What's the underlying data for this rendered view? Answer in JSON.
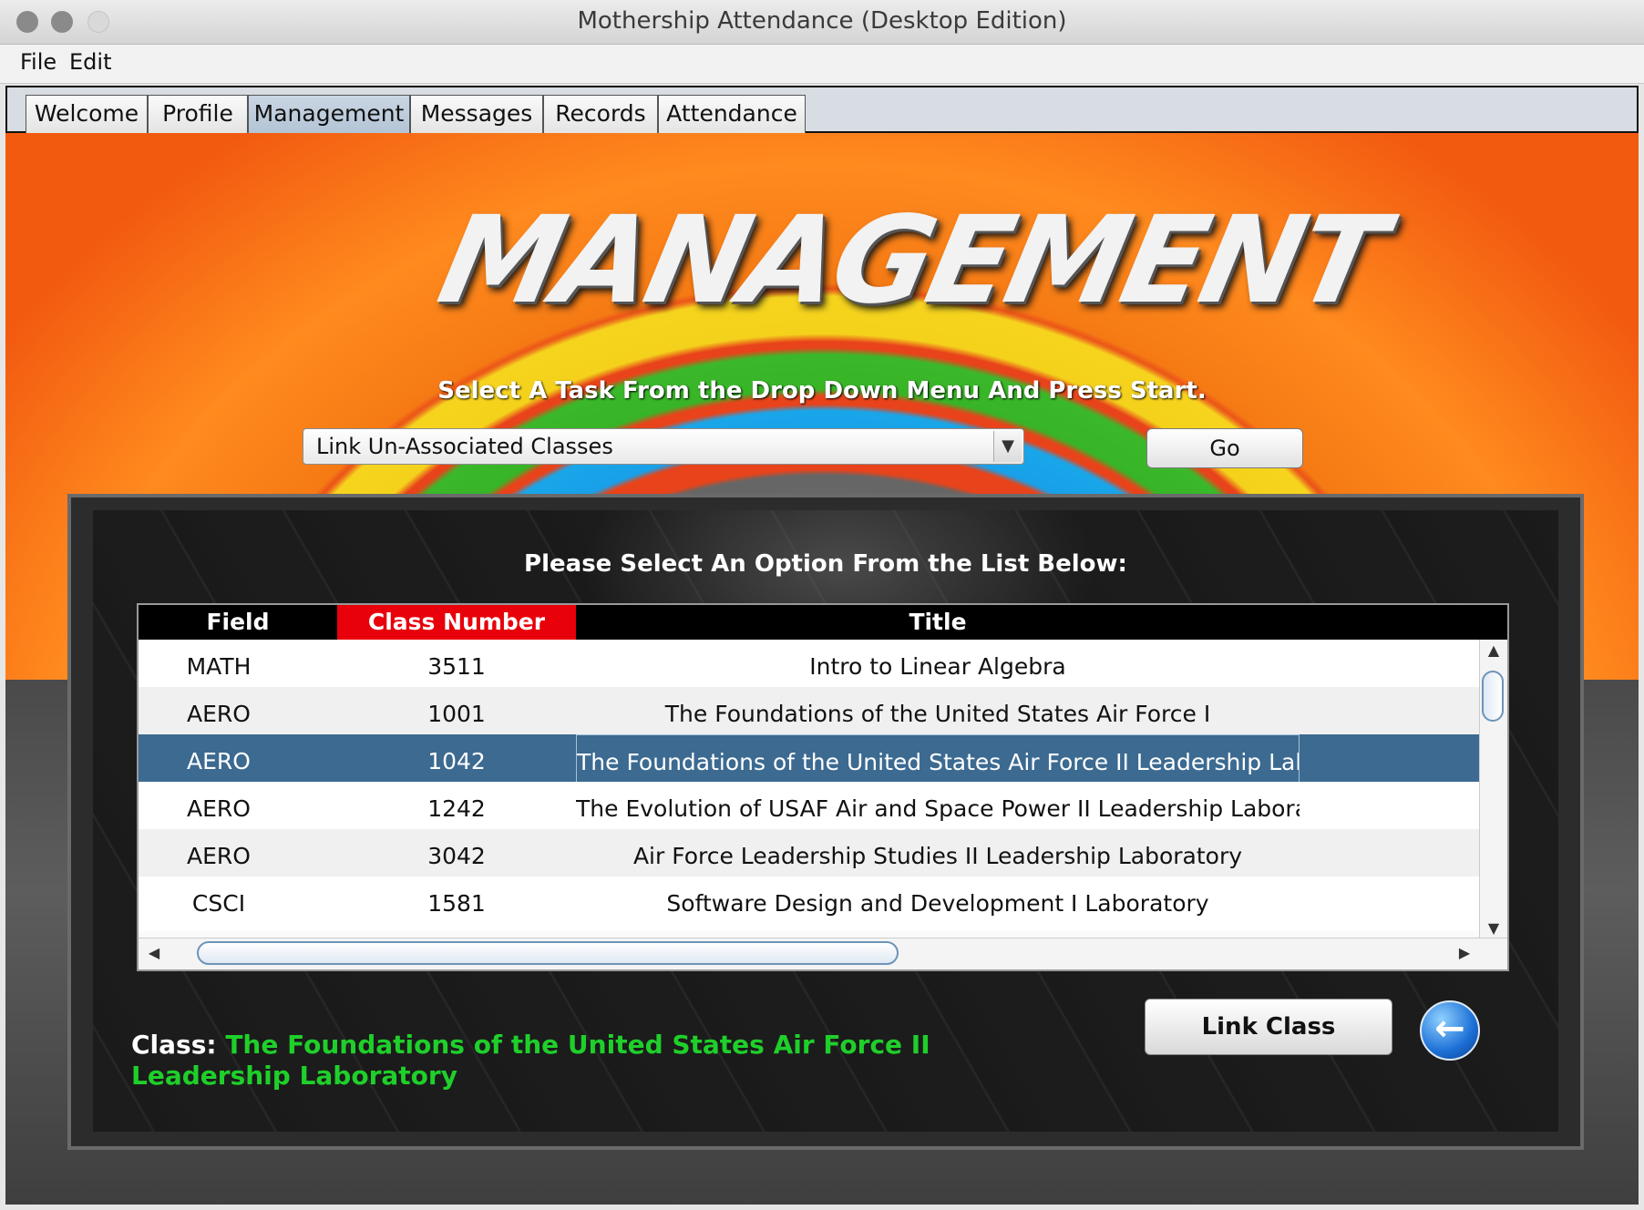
{
  "window": {
    "title": "Mothership Attendance (Desktop Edition)"
  },
  "menu": {
    "file": "File",
    "edit": "Edit"
  },
  "tabs": [
    {
      "label": "Welcome"
    },
    {
      "label": "Profile"
    },
    {
      "label": "Management",
      "active": true
    },
    {
      "label": "Messages"
    },
    {
      "label": "Records"
    },
    {
      "label": "Attendance"
    }
  ],
  "header": {
    "logo_text": "MANAGEMENT",
    "instruction": "Select A Task From the Drop Down Menu And Press Start."
  },
  "task_select": {
    "value": "Link Un-Associated Classes",
    "go_label": "Go"
  },
  "panel": {
    "heading": "Please Select An Option From the List Below:"
  },
  "table": {
    "columns": [
      "Field",
      "Class Number",
      "Title"
    ],
    "sorted_column": "Class Number",
    "rows": [
      {
        "field": "MATH",
        "number": "3511",
        "title": "Intro to Linear Algebra"
      },
      {
        "field": "AERO",
        "number": "1001",
        "title": "The Foundations of the United States Air Force I"
      },
      {
        "field": "AERO",
        "number": "1042",
        "title": "The Foundations of the United States Air Force II Leadership Laboratory",
        "selected": true
      },
      {
        "field": "AERO",
        "number": "1242",
        "title": "The Evolution of USAF Air and Space Power II Leadership Laboratory"
      },
      {
        "field": "AERO",
        "number": "3042",
        "title": "Air Force Leadership Studies II Leadership Laboratory"
      },
      {
        "field": "CSCI",
        "number": "1581",
        "title": "Software Design and Development I Laboratory"
      }
    ]
  },
  "selection": {
    "label": "Class:",
    "value": "The Foundations of the United States Air Force II Leadership Laboratory"
  },
  "actions": {
    "link_label": "Link Class",
    "back_icon": "back-arrow-icon"
  },
  "colors": {
    "selected_row": "#3c6a91",
    "sorted_header": "#e8000a",
    "class_value": "#1fcf2a"
  }
}
